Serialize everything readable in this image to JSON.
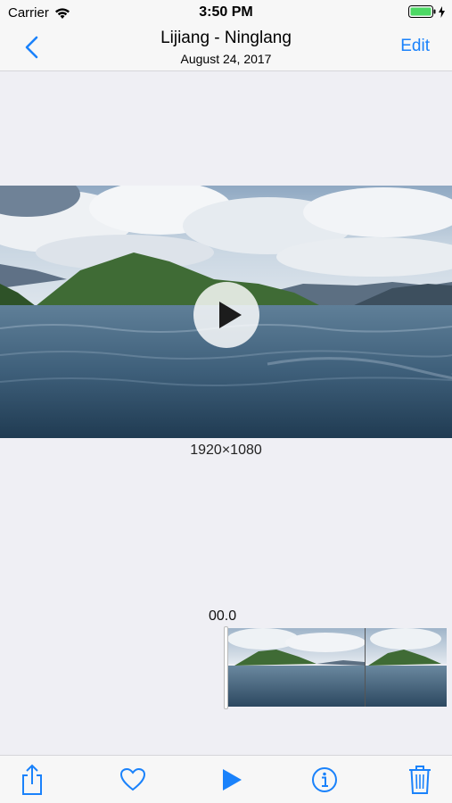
{
  "status_bar": {
    "carrier": "Carrier",
    "time": "3:50 PM"
  },
  "nav": {
    "title": "Lijiang - Ninglang",
    "subtitle": "August 24, 2017",
    "edit_label": "Edit"
  },
  "video": {
    "resolution": "1920×1080"
  },
  "scrubber": {
    "timecode": "00.0"
  },
  "icons": {
    "back": "chevron-left-icon",
    "play_overlay": "play-icon",
    "share": "share-icon",
    "favorite": "heart-icon",
    "play": "play-icon",
    "info": "info-icon",
    "delete": "trash-icon"
  },
  "colors": {
    "accent": "#1a82fb",
    "battery": "#4cd964"
  }
}
